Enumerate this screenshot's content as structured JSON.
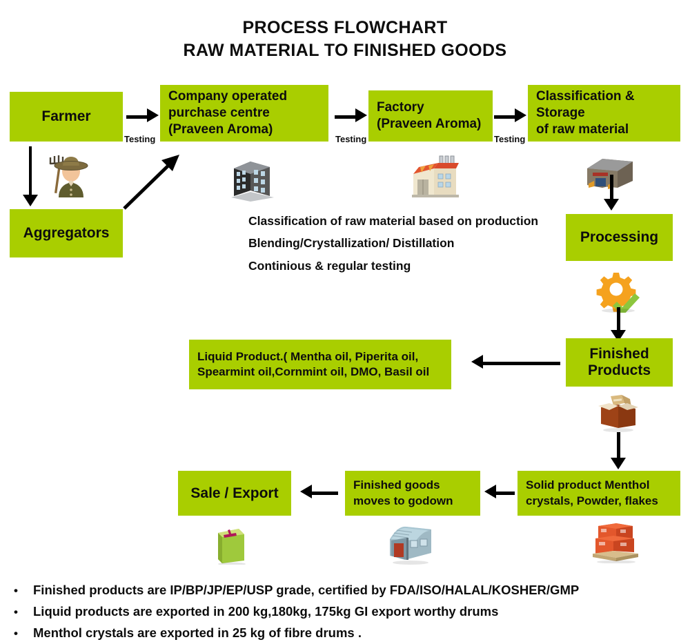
{
  "title": {
    "line1": "PROCESS FLOWCHART",
    "line2": "RAW MATERIAL TO FINISHED GOODS"
  },
  "colors": {
    "box_green": "#A9CE00",
    "arrow_black": "#000000",
    "text_black": "#0d0d0d",
    "gear_orange": "#F5A21E",
    "check_green": "#8CC63E",
    "carton_brown": "#A8491B",
    "pallet_red": "#E0532A"
  },
  "nodes": {
    "farmer": "Farmer",
    "aggregators": "Aggregators",
    "purchase_centre": "Company operated\npurchase centre\n(Praveen Aroma)",
    "factory": "Factory\n(Praveen Aroma)",
    "classification_storage": "Classification &  Storage\nof raw material",
    "processing": "Processing",
    "finished_products": "Finished\nProducts",
    "liquid_product": "Liquid Product.( Mentha oil, Piperita oil,\nSpearmint oil,Cornmint oil, DMO, Basil oil",
    "solid_product": "Solid product Menthol\ncrystals, Powder, flakes",
    "godown": "Finished goods\nmoves to godown",
    "sale_export": "Sale / Export"
  },
  "edge_labels": {
    "testing_1": "Testing",
    "testing_2": "Testing",
    "testing_3": "Testing"
  },
  "notes": [
    "Classification of raw material based on production",
    "Blending/Crystallization/ Distillation",
    "Continious & regular testing"
  ],
  "bullets": [
    {
      "marker": "•",
      "text": "Finished products are IP/BP/JP/EP/USP grade, certified by FDA/ISO/HALAL/KOSHER/GMP"
    },
    {
      "marker": "•",
      "text": "Liquid products are exported in 200 kg,180kg, 175kg  GI export  worthy drums"
    },
    {
      "marker": "•",
      "text": "Menthol crystals are exported in 25 kg of fibre drums ."
    }
  ],
  "icons": {
    "farmer": "farmer-icon",
    "office_building": "office-building-icon",
    "factory": "factory-icon",
    "warehouse_storage": "warehouse-storage-icon",
    "gear_check": "gear-check-icon",
    "open_carton": "open-carton-box-icon",
    "shopping_bag": "shopping-bag-icon",
    "godown": "godown-shed-icon",
    "pallet_boxes": "pallet-boxes-icon"
  }
}
